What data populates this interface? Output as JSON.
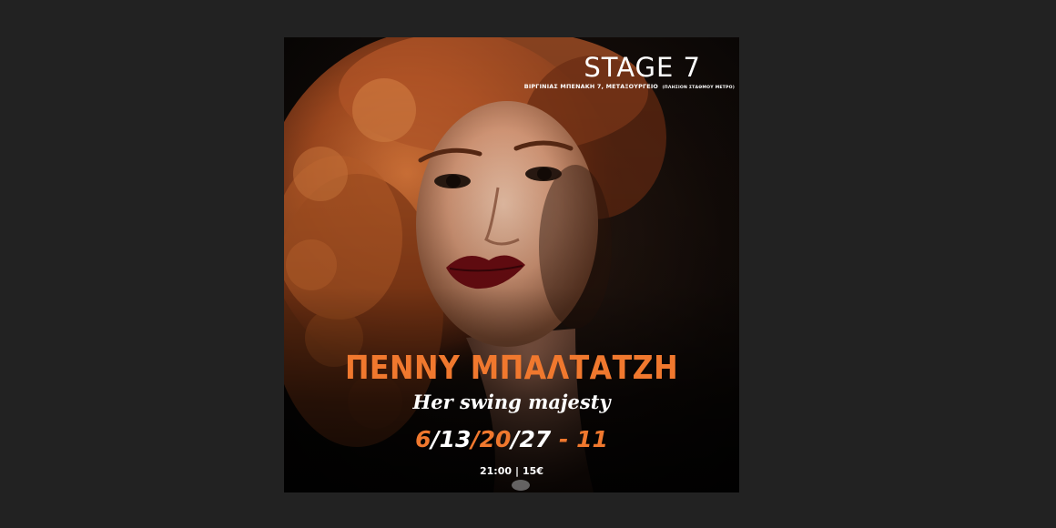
{
  "venue": {
    "name": "STAGE 7",
    "address": "ΒΙΡΓΙΝΙΑΣ ΜΠΕΝΑΚΗ 7, ΜΕΤΑΞΟΥΡΓΕΙΟ",
    "address_note": "(ΠΛΗΣΙΟΝ ΣΤΑΘΜΟΥ ΜΕΤΡΟ)"
  },
  "event": {
    "artist": "ΠΕΝΝΥ ΜΠΑΛΤΑΤΖΗ",
    "subtitle": "Her swing majesty",
    "dates": [
      {
        "text": "6",
        "color": "orange"
      },
      {
        "text": "/",
        "color": "white"
      },
      {
        "text": "13",
        "color": "white"
      },
      {
        "text": "/",
        "color": "orange"
      },
      {
        "text": "20",
        "color": "orange"
      },
      {
        "text": "/",
        "color": "white"
      },
      {
        "text": "27",
        "color": "white"
      },
      {
        "text": " - 11",
        "color": "orange"
      }
    ],
    "time": "21:00",
    "separator": "|",
    "price": "15€"
  },
  "colors": {
    "accent": "#f0782e",
    "page_background": "#222222",
    "poster_background": "#0b0807"
  }
}
